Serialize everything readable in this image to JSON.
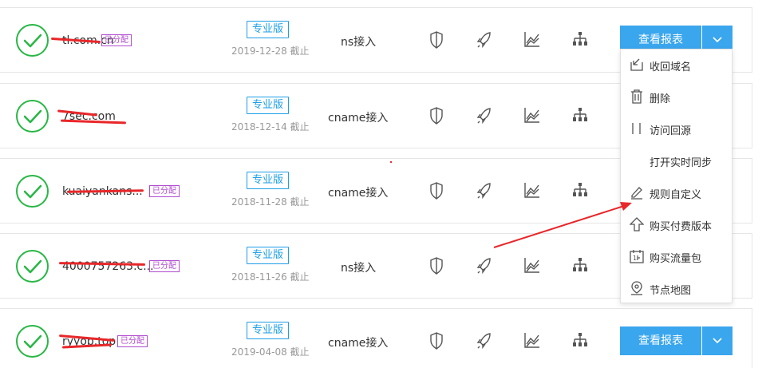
{
  "rows": [
    {
      "domain": "tl.com.cn",
      "badge": "已分配",
      "edition": "专业版",
      "expire": "2019-12-28 截止",
      "access": "ns接入",
      "report_label": "查看报表"
    },
    {
      "domain": "7sec.com",
      "badge": "",
      "edition": "专业版",
      "expire": "2018-12-14 截止",
      "access": "cname接入",
      "report_label": ""
    },
    {
      "domain": "kuaiyankans...",
      "badge": "已分配",
      "edition": "专业版",
      "expire": "2018-11-28 截止",
      "access": "cname接入",
      "report_label": ""
    },
    {
      "domain": "4000757263.c...",
      "badge": "已分配",
      "edition": "专业版",
      "expire": "2018-11-26 截止",
      "access": "ns接入",
      "report_label": ""
    },
    {
      "domain": "ryyop.top",
      "badge": "已分配",
      "edition": "专业版",
      "expire": "2019-04-08 截止",
      "access": "cname接入",
      "report_label": "查看报表"
    }
  ],
  "row_icons": [
    "shield-icon",
    "rocket-icon",
    "chart-icon",
    "sitemap-icon"
  ],
  "dropdown": {
    "items": [
      {
        "label": "收回域名",
        "icon": "retract-icon"
      },
      {
        "label": "删除",
        "icon": "trash-icon"
      },
      {
        "label": "访问回源",
        "icon": "origin-icon"
      },
      {
        "label": "打开实时同步",
        "icon": ""
      },
      {
        "label": "规则自定义",
        "icon": "pencil-icon"
      },
      {
        "label": "购买付费版本",
        "icon": "upgrade-icon"
      },
      {
        "label": "购买流量包",
        "icon": "traffic-pack-icon"
      },
      {
        "label": "节点地图",
        "icon": "map-pin-icon"
      }
    ]
  },
  "colors": {
    "primary": "#3aa6ee",
    "success": "#28b745",
    "badge": "#b04bd0",
    "edition": "#1e9fe6",
    "annotation": "#e8272a"
  }
}
